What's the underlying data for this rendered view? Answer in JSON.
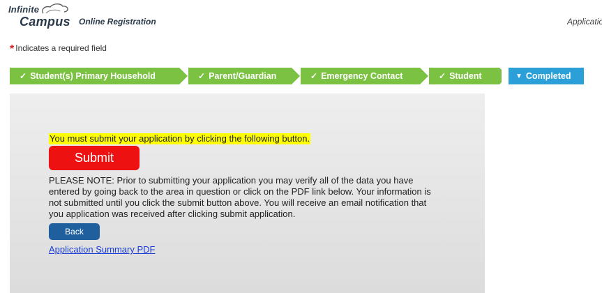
{
  "header": {
    "logo_top": "Infinite",
    "logo_bottom": "Campus",
    "title": "Online Registration",
    "right_text": "Application"
  },
  "required_note": {
    "star": "*",
    "text": "Indicates a required field"
  },
  "steps": [
    {
      "label": "Student(s) Primary Household",
      "status": "complete",
      "icon": "check-icon"
    },
    {
      "label": "Parent/Guardian",
      "status": "complete",
      "icon": "check-icon"
    },
    {
      "label": "Emergency Contact",
      "status": "complete",
      "icon": "check-icon"
    },
    {
      "label": "Student",
      "status": "complete",
      "icon": "check-icon"
    },
    {
      "label": "Completed",
      "status": "current",
      "icon": "triangle-down-icon"
    }
  ],
  "colors": {
    "step_complete": "#7bc142",
    "step_current": "#2a9fd8",
    "submit": "#ee1111",
    "back": "#1f5f9e",
    "highlight": "#ffff00",
    "link": "#1a3cd6"
  },
  "main": {
    "instruction": "You must submit your application by clicking the following button.",
    "submit_label": "Submit",
    "note": "PLEASE NOTE: Prior to submitting your application you may verify all of the data you have entered by going back to the area in question or click on the PDF link below. Your information is not submitted until you click the submit button above. You will receive an email notification that you application was received after clicking submit application.",
    "back_label": "Back",
    "pdf_link": "Application Summary PDF"
  }
}
